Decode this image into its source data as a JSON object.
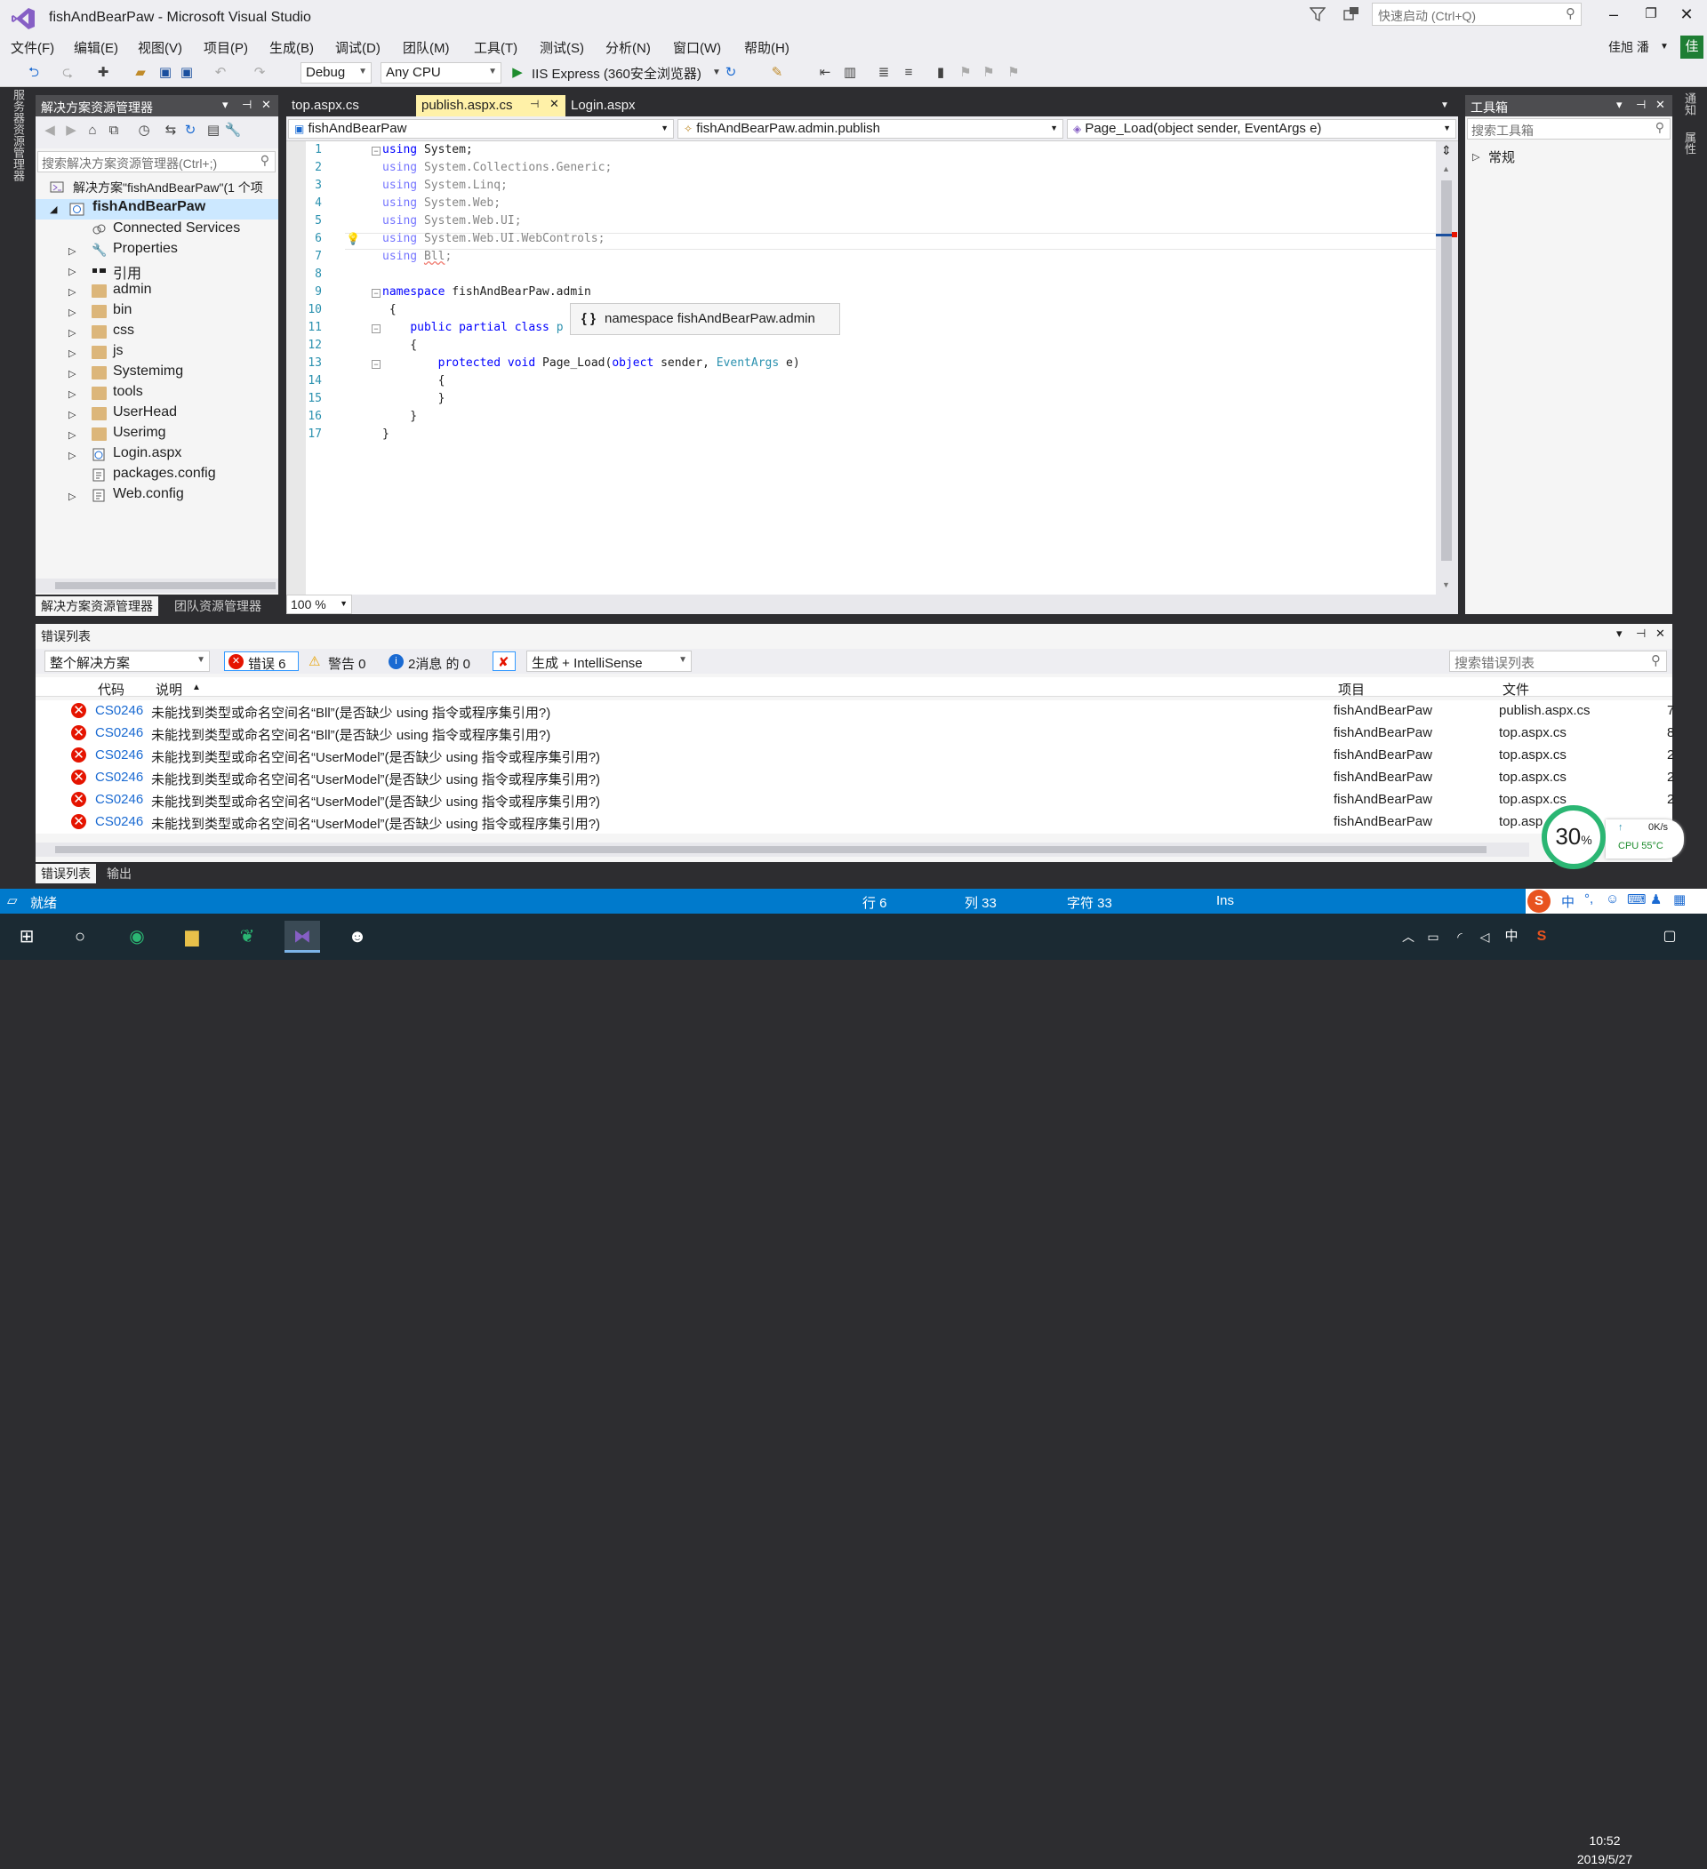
{
  "window": {
    "title": "fishAndBearPaw - Microsoft Visual Studio",
    "quick_launch_placeholder": "快速启动 (Ctrl+Q)",
    "user": "佳旭 潘",
    "user_badge": "佳"
  },
  "menu": [
    "文件(F)",
    "编辑(E)",
    "视图(V)",
    "项目(P)",
    "生成(B)",
    "调试(D)",
    "团队(M)",
    "工具(T)",
    "测试(S)",
    "分析(N)",
    "窗口(W)",
    "帮助(H)"
  ],
  "toolbar": {
    "config": "Debug",
    "platform": "Any CPU",
    "run_label": "IIS Express (360安全浏览器)"
  },
  "left_strip": {
    "vertical_label": "服务器资源管理器"
  },
  "right_strip": {
    "labels": [
      "通知",
      "属性"
    ]
  },
  "solution_explorer": {
    "title": "解决方案资源管理器",
    "search_placeholder": "搜索解决方案资源管理器(Ctrl+;)",
    "solution_label": "解决方案\"fishAndBearPaw\"(1 个项",
    "project": "fishAndBearPaw",
    "items": [
      {
        "label": "Connected Services",
        "icon": "connected-services-icon",
        "expandable": false
      },
      {
        "label": "Properties",
        "icon": "wrench-icon",
        "expandable": true
      },
      {
        "label": "引用",
        "icon": "references-icon",
        "expandable": true
      },
      {
        "label": "admin",
        "icon": "folder-icon",
        "expandable": true
      },
      {
        "label": "bin",
        "icon": "folder-icon",
        "expandable": true
      },
      {
        "label": "css",
        "icon": "folder-icon",
        "expandable": true
      },
      {
        "label": "js",
        "icon": "folder-icon",
        "expandable": true
      },
      {
        "label": "Systemimg",
        "icon": "folder-icon",
        "expandable": true
      },
      {
        "label": "tools",
        "icon": "folder-icon",
        "expandable": true
      },
      {
        "label": "UserHead",
        "icon": "folder-icon",
        "expandable": true
      },
      {
        "label": "Userimg",
        "icon": "folder-icon",
        "expandable": true
      },
      {
        "label": "Login.aspx",
        "icon": "aspx-file-icon",
        "expandable": true
      },
      {
        "label": "packages.config",
        "icon": "config-file-icon",
        "expandable": false
      },
      {
        "label": "Web.config",
        "icon": "config-file-icon",
        "expandable": true
      }
    ],
    "tabs": [
      "解决方案资源管理器",
      "团队资源管理器"
    ]
  },
  "editor": {
    "tabs": [
      {
        "label": "top.aspx.cs",
        "active": false
      },
      {
        "label": "publish.aspx.cs",
        "active": true
      },
      {
        "label": "Login.aspx",
        "active": false
      }
    ],
    "nav_project": "fishAndBearPaw",
    "nav_class": "fishAndBearPaw.admin.publish",
    "nav_member": "Page_Load(object sender, EventArgs e)",
    "line_numbers": [
      "1",
      "2",
      "3",
      "4",
      "5",
      "6",
      "7",
      "8",
      "9",
      "10",
      "11",
      "12",
      "13",
      "14",
      "15",
      "16",
      "17"
    ],
    "tooltip": "namespace fishAndBearPaw.admin",
    "tooltip_icon": "{ }",
    "zoom": "100 %"
  },
  "toolbox": {
    "title": "工具箱",
    "search_placeholder": "搜索工具箱",
    "group": "常规"
  },
  "error_list": {
    "title": "错误列表",
    "scope": "整个解决方案",
    "errors_btn": "错误 6",
    "warnings_btn": "警告 0",
    "messages_btn": "2消息 的 0",
    "build_filter": "生成 + IntelliSense",
    "search_placeholder": "搜索错误列表",
    "columns": {
      "code": "代码",
      "desc": "说明",
      "project": "项目",
      "file": "文件"
    },
    "rows": [
      {
        "code": "CS0246",
        "desc": "未能找到类型或命名空间名“Bll”(是否缺少 using 指令或程序集引用?)",
        "project": "fishAndBearPaw",
        "file": "publish.aspx.cs",
        "line": "7"
      },
      {
        "code": "CS0246",
        "desc": "未能找到类型或命名空间名“Bll”(是否缺少 using 指令或程序集引用?)",
        "project": "fishAndBearPaw",
        "file": "top.aspx.cs",
        "line": "8"
      },
      {
        "code": "CS0246",
        "desc": "未能找到类型或命名空间名“UserModel”(是否缺少 using 指令或程序集引用?)",
        "project": "fishAndBearPaw",
        "file": "top.aspx.cs",
        "line": "2"
      },
      {
        "code": "CS0246",
        "desc": "未能找到类型或命名空间名“UserModel”(是否缺少 using 指令或程序集引用?)",
        "project": "fishAndBearPaw",
        "file": "top.aspx.cs",
        "line": "2"
      },
      {
        "code": "CS0246",
        "desc": "未能找到类型或命名空间名“UserModel”(是否缺少 using 指令或程序集引用?)",
        "project": "fishAndBearPaw",
        "file": "top.aspx.cs",
        "line": "2"
      },
      {
        "code": "CS0246",
        "desc": "未能找到类型或命名空间名“UserModel”(是否缺少 using 指令或程序集引用?)",
        "project": "fishAndBearPaw",
        "file": "top.asp",
        "line": ""
      }
    ],
    "tabs": [
      "错误列表",
      "输出"
    ]
  },
  "status": {
    "ready": "就绪",
    "line": "行 6",
    "col": "列 33",
    "char": "字符 33",
    "mode": "Ins"
  },
  "monitor": {
    "cpu_percent": "30",
    "percent_sign": "%",
    "net": "0K/s",
    "cpu_temp": "CPU 55°C"
  },
  "taskbar": {
    "time": "10:52",
    "date": "2019/5/27",
    "ime": "中"
  },
  "colors": {
    "accent": "#007acc",
    "error": "#e51400",
    "keyword": "#0000ff",
    "type": "#2b91af"
  }
}
